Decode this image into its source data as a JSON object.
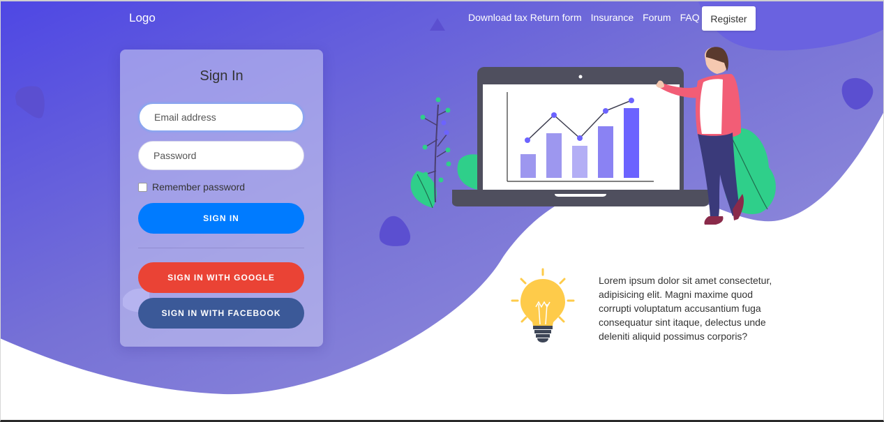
{
  "header": {
    "logo": "Logo",
    "nav": [
      "Download tax Return form",
      "Insurance",
      "Forum",
      "FAQ"
    ],
    "register_label": "Register"
  },
  "signin": {
    "title": "Sign In",
    "email_placeholder": "Email address",
    "password_placeholder": "Password",
    "remember_label": "Remember password",
    "signin_label": "SIGN IN",
    "google_label": "SIGN IN WITH GOOGLE",
    "facebook_label": "SIGN IN WITH FACEBOOK"
  },
  "info": {
    "icon": "lightbulb-icon",
    "text": "Lorem ipsum dolor sit amet consectetur, adipisicing elit. Magni maxime quod corrupti voluptatum accusantium fuga consequatur sint itaque, delectus unde deleniti aliquid possimus corporis?"
  },
  "colors": {
    "gradient_start": "#4f46e5",
    "gradient_end": "#8e8bd8",
    "signin_button": "#007bff",
    "google_button": "#ea4335",
    "facebook_button": "#3b5998"
  }
}
